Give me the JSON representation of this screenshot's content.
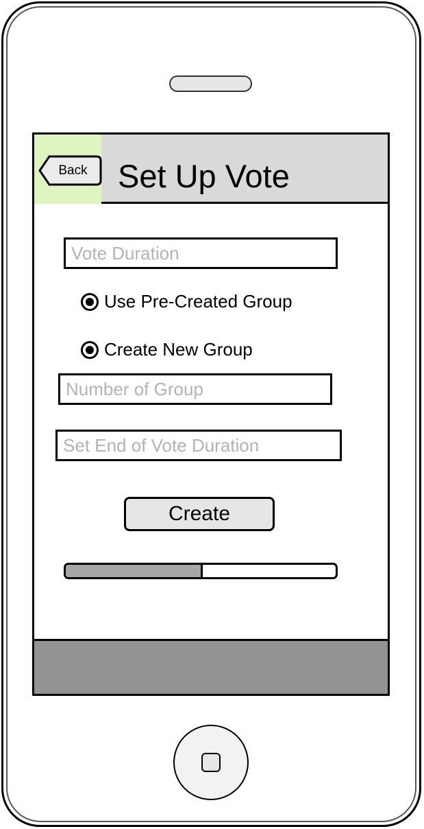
{
  "header": {
    "back_label": "Back",
    "title": "Set Up Vote"
  },
  "form": {
    "vote_duration_placeholder": "Vote Duration",
    "radio_precreated_label": "Use Pre-Created Group",
    "radio_new_label": "Create New Group",
    "number_of_group_placeholder": "Number of Group",
    "end_duration_placeholder": "Set End of Vote Duration",
    "create_label": "Create"
  },
  "progress": {
    "fraction": 0.5
  },
  "icons": {
    "back": "back-arrow-icon",
    "home": "home-button-icon",
    "radio_selected": "radio-selected-icon"
  },
  "colors": {
    "header_bg": "#d9d9d9",
    "back_area_bg": "#def5c2",
    "footer_bg": "#939393",
    "progress_fill": "#a6a6a6",
    "placeholder_text": "#b3b3b3"
  }
}
